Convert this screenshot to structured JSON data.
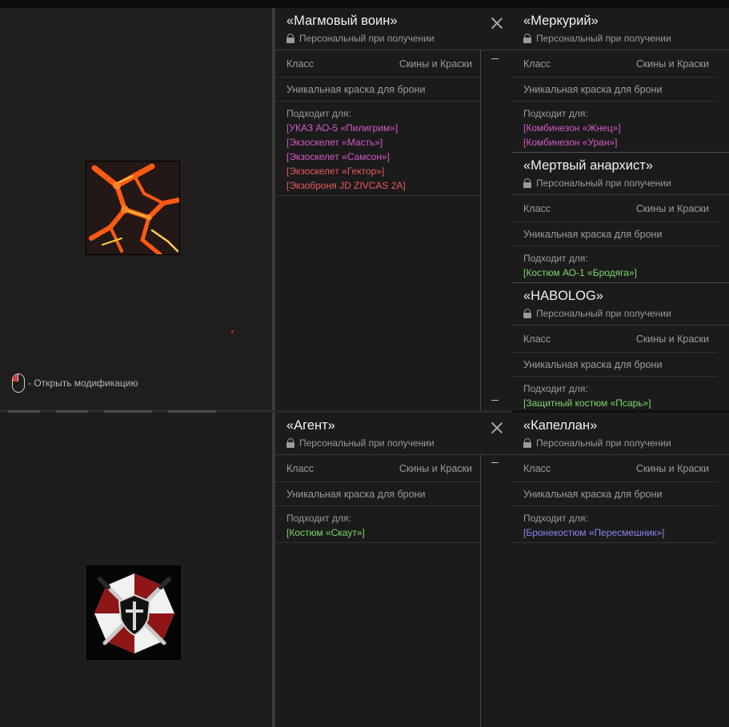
{
  "hint": {
    "text": "- Открыть модификацию"
  },
  "common": {
    "personal": "Персональный при получении",
    "class_label": "Класс",
    "class_value": "Скины и Краски",
    "description": "Уникальная краска для брони",
    "fits_label": "Подходит для:"
  },
  "cards": {
    "magma": {
      "title": "«Магмовый воин»",
      "fits": [
        "[УКАЗ АО-5 «Пилигрим»]",
        "[Экзоскелет «Масть»]",
        "[Экзоскелет «Самсон»]",
        "[Экзоскелет «Гектор»]",
        "[Экзоброня JD ZIVCAS 2A]"
      ]
    },
    "mercury": {
      "title": "«Меркурий»",
      "fits": [
        "[Комбинезон «Жнец»]",
        "[Комбинезон «Уран»]"
      ]
    },
    "anarchist": {
      "title": "«Мертвый анархист»",
      "fits": [
        "[Костюм АО-1 «Бродяга»]"
      ]
    },
    "habolog": {
      "title": "«HABOLOG»",
      "fits": [
        "[Защитный костюм «Псарь»]"
      ]
    },
    "agent": {
      "title": "«Агент»",
      "fits": [
        "[Костюм «Скаут»]"
      ]
    },
    "chaplain": {
      "title": "«Капеллан»",
      "fits": [
        "[Бронекостюм «Пересмешник»]"
      ]
    }
  },
  "colors": {
    "pink": "#d45ac8",
    "red": "#e85a5a",
    "green": "#7bd86a",
    "blue": "#8a86f0"
  }
}
